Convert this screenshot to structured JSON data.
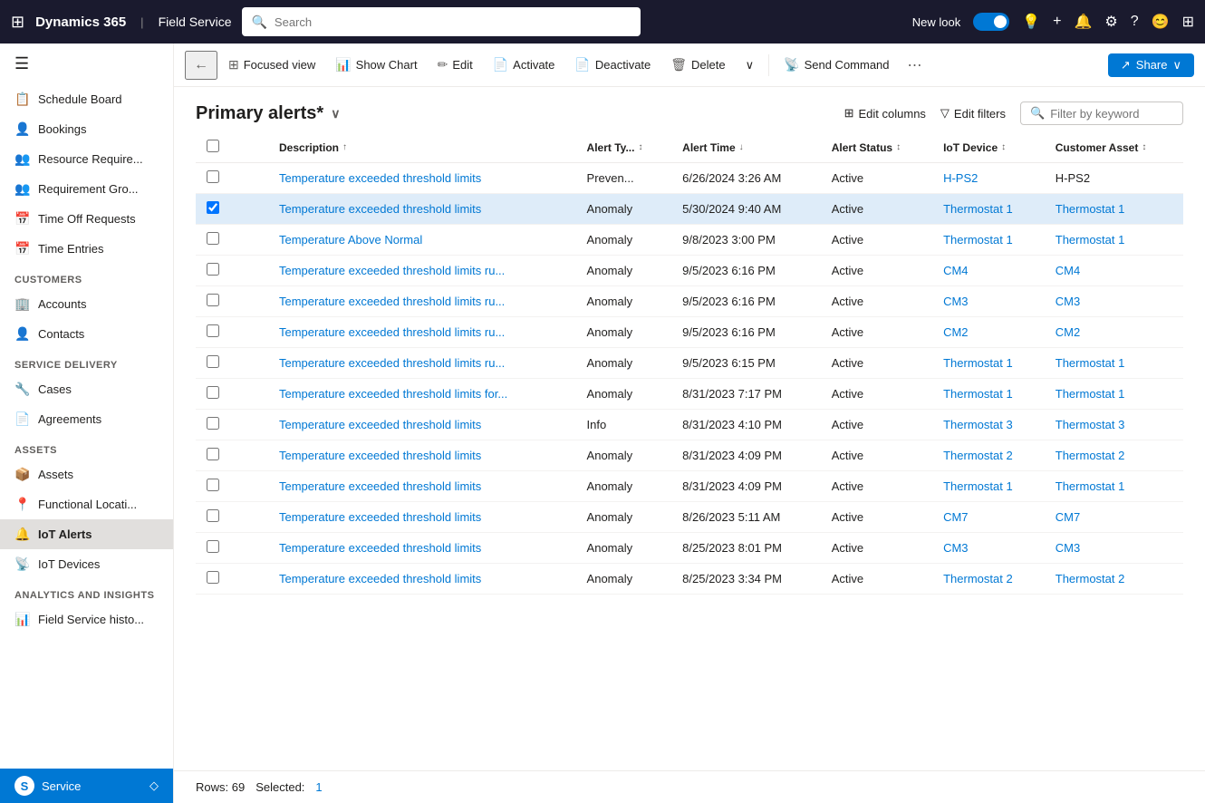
{
  "topNav": {
    "brand": "Dynamics 365",
    "divider": "|",
    "app": "Field Service",
    "searchPlaceholder": "Search",
    "newLookLabel": "New look"
  },
  "sidebar": {
    "hamburgerIcon": "☰",
    "items": [
      {
        "id": "schedule-board",
        "label": "Schedule Board",
        "icon": "📋"
      },
      {
        "id": "bookings",
        "label": "Bookings",
        "icon": "👤"
      },
      {
        "id": "resource-require",
        "label": "Resource Require...",
        "icon": "👥"
      },
      {
        "id": "requirement-gro",
        "label": "Requirement Gro...",
        "icon": "👥"
      },
      {
        "id": "time-off-requests",
        "label": "Time Off Requests",
        "icon": "📅"
      },
      {
        "id": "time-entries",
        "label": "Time Entries",
        "icon": "📅"
      }
    ],
    "sections": [
      {
        "label": "Customers",
        "items": [
          {
            "id": "accounts",
            "label": "Accounts",
            "icon": "🏢"
          },
          {
            "id": "contacts",
            "label": "Contacts",
            "icon": "👤"
          }
        ]
      },
      {
        "label": "Service Delivery",
        "items": [
          {
            "id": "cases",
            "label": "Cases",
            "icon": "🔧"
          },
          {
            "id": "agreements",
            "label": "Agreements",
            "icon": "📄"
          }
        ]
      },
      {
        "label": "Assets",
        "items": [
          {
            "id": "assets",
            "label": "Assets",
            "icon": "📦"
          },
          {
            "id": "functional-locati",
            "label": "Functional Locati...",
            "icon": "📍"
          },
          {
            "id": "iot-alerts",
            "label": "IoT Alerts",
            "icon": "🔔",
            "active": true
          },
          {
            "id": "iot-devices",
            "label": "IoT Devices",
            "icon": "📡"
          }
        ]
      },
      {
        "label": "Analytics and Insights",
        "items": [
          {
            "id": "field-service-histo",
            "label": "Field Service histo...",
            "icon": "📊"
          }
        ]
      }
    ],
    "bottomLabel": "Service",
    "bottomIcon": "S"
  },
  "toolbar": {
    "backIcon": "←",
    "focusedViewLabel": "Focused view",
    "showChartLabel": "Show Chart",
    "editLabel": "Edit",
    "activateLabel": "Activate",
    "deactivateLabel": "Deactivate",
    "deleteLabel": "Delete",
    "moreIcon": "∨",
    "sendCommandLabel": "Send Command",
    "moreOptionsIcon": "⋯",
    "shareLabel": "Share",
    "shareIcon": "↗"
  },
  "listHeader": {
    "title": "Primary alerts*",
    "chevronIcon": "∨",
    "editColumnsLabel": "Edit columns",
    "editFiltersLabel": "Edit filters",
    "filterPlaceholder": "Filter by keyword"
  },
  "table": {
    "columns": [
      {
        "id": "description",
        "label": "Description",
        "sortable": true,
        "sortDir": "asc"
      },
      {
        "id": "alert-type",
        "label": "Alert Ty...",
        "sortable": true
      },
      {
        "id": "alert-time",
        "label": "Alert Time",
        "sortable": true,
        "sortDir": "desc"
      },
      {
        "id": "alert-status",
        "label": "Alert Status",
        "sortable": true
      },
      {
        "id": "iot-device",
        "label": "IoT Device",
        "sortable": true
      },
      {
        "id": "customer-asset",
        "label": "Customer Asset",
        "sortable": true
      }
    ],
    "rows": [
      {
        "id": 1,
        "description": "Temperature exceeded threshold limits",
        "alertType": "Preven...",
        "alertTime": "6/26/2024 3:26 AM",
        "alertStatus": "Active",
        "iotDevice": "H-PS2",
        "iotDeviceLink": true,
        "customerAsset": "H-PS2",
        "customerAssetLink": false,
        "selected": false
      },
      {
        "id": 2,
        "description": "Temperature exceeded threshold limits",
        "alertType": "Anomaly",
        "alertTime": "5/30/2024 9:40 AM",
        "alertStatus": "Active",
        "iotDevice": "Thermostat 1",
        "iotDeviceLink": true,
        "customerAsset": "Thermostat 1",
        "customerAssetLink": true,
        "selected": true
      },
      {
        "id": 3,
        "description": "Temperature Above Normal",
        "alertType": "Anomaly",
        "alertTime": "9/8/2023 3:00 PM",
        "alertStatus": "Active",
        "iotDevice": "Thermostat 1",
        "iotDeviceLink": true,
        "customerAsset": "Thermostat 1",
        "customerAssetLink": true,
        "selected": false
      },
      {
        "id": 4,
        "description": "Temperature exceeded threshold limits ru...",
        "alertType": "Anomaly",
        "alertTime": "9/5/2023 6:16 PM",
        "alertStatus": "Active",
        "iotDevice": "CM4",
        "iotDeviceLink": true,
        "customerAsset": "CM4",
        "customerAssetLink": true,
        "selected": false
      },
      {
        "id": 5,
        "description": "Temperature exceeded threshold limits ru...",
        "alertType": "Anomaly",
        "alertTime": "9/5/2023 6:16 PM",
        "alertStatus": "Active",
        "iotDevice": "CM3",
        "iotDeviceLink": true,
        "customerAsset": "CM3",
        "customerAssetLink": true,
        "selected": false
      },
      {
        "id": 6,
        "description": "Temperature exceeded threshold limits ru...",
        "alertType": "Anomaly",
        "alertTime": "9/5/2023 6:16 PM",
        "alertStatus": "Active",
        "iotDevice": "CM2",
        "iotDeviceLink": true,
        "customerAsset": "CM2",
        "customerAssetLink": true,
        "selected": false
      },
      {
        "id": 7,
        "description": "Temperature exceeded threshold limits ru...",
        "alertType": "Anomaly",
        "alertTime": "9/5/2023 6:15 PM",
        "alertStatus": "Active",
        "iotDevice": "Thermostat 1",
        "iotDeviceLink": true,
        "customerAsset": "Thermostat 1",
        "customerAssetLink": true,
        "selected": false
      },
      {
        "id": 8,
        "description": "Temperature exceeded threshold limits for...",
        "alertType": "Anomaly",
        "alertTime": "8/31/2023 7:17 PM",
        "alertStatus": "Active",
        "iotDevice": "Thermostat 1",
        "iotDeviceLink": true,
        "customerAsset": "Thermostat 1",
        "customerAssetLink": true,
        "selected": false
      },
      {
        "id": 9,
        "description": "Temperature exceeded threshold limits",
        "alertType": "Info",
        "alertTime": "8/31/2023 4:10 PM",
        "alertStatus": "Active",
        "iotDevice": "Thermostat 3",
        "iotDeviceLink": true,
        "customerAsset": "Thermostat 3",
        "customerAssetLink": true,
        "selected": false
      },
      {
        "id": 10,
        "description": "Temperature exceeded threshold limits",
        "alertType": "Anomaly",
        "alertTime": "8/31/2023 4:09 PM",
        "alertStatus": "Active",
        "iotDevice": "Thermostat 2",
        "iotDeviceLink": true,
        "customerAsset": "Thermostat 2",
        "customerAssetLink": true,
        "selected": false
      },
      {
        "id": 11,
        "description": "Temperature exceeded threshold limits",
        "alertType": "Anomaly",
        "alertTime": "8/31/2023 4:09 PM",
        "alertStatus": "Active",
        "iotDevice": "Thermostat 1",
        "iotDeviceLink": true,
        "customerAsset": "Thermostat 1",
        "customerAssetLink": true,
        "selected": false
      },
      {
        "id": 12,
        "description": "Temperature exceeded threshold limits",
        "alertType": "Anomaly",
        "alertTime": "8/26/2023 5:11 AM",
        "alertStatus": "Active",
        "iotDevice": "CM7",
        "iotDeviceLink": true,
        "customerAsset": "CM7",
        "customerAssetLink": true,
        "selected": false
      },
      {
        "id": 13,
        "description": "Temperature exceeded threshold limits",
        "alertType": "Anomaly",
        "alertTime": "8/25/2023 8:01 PM",
        "alertStatus": "Active",
        "iotDevice": "CM3",
        "iotDeviceLink": true,
        "customerAsset": "CM3",
        "customerAssetLink": true,
        "selected": false
      },
      {
        "id": 14,
        "description": "Temperature exceeded threshold limits",
        "alertType": "Anomaly",
        "alertTime": "8/25/2023 3:34 PM",
        "alertStatus": "Active",
        "iotDevice": "Thermostat 2",
        "iotDeviceLink": true,
        "customerAsset": "Thermostat 2",
        "customerAssetLink": true,
        "selected": false
      }
    ]
  },
  "statusBar": {
    "rowsLabel": "Rows: 69",
    "selectedLabel": "Selected:",
    "selectedCount": "1"
  }
}
